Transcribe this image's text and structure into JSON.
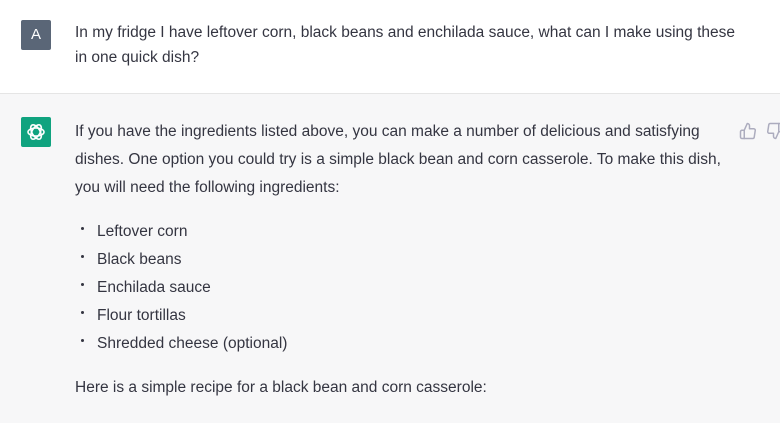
{
  "user_message": {
    "avatar_letter": "A",
    "text": "In my fridge I have leftover corn, black beans and enchilada sauce, what can I make using these in one quick dish?"
  },
  "assistant_message": {
    "paragraph_1": "If you have the ingredients listed above, you can make a number of delicious and satisfying dishes. One option you could try is a simple black bean and corn casserole. To make this dish, you will need the following ingredients:",
    "ingredients": [
      "Leftover corn",
      "Black beans",
      "Enchilada sauce",
      "Flour tortillas",
      "Shredded cheese (optional)"
    ],
    "paragraph_2": "Here is a simple recipe for a black bean and corn casserole:"
  },
  "icons": {
    "assistant_avatar": "openai-logo-icon",
    "feedback_up": "thumbs-up-icon",
    "feedback_down": "thumbs-down-icon"
  },
  "colors": {
    "user_avatar_bg": "#5a6677",
    "assistant_avatar_bg": "#10a37f",
    "assistant_row_bg": "#f7f7f8",
    "text": "#343541"
  }
}
